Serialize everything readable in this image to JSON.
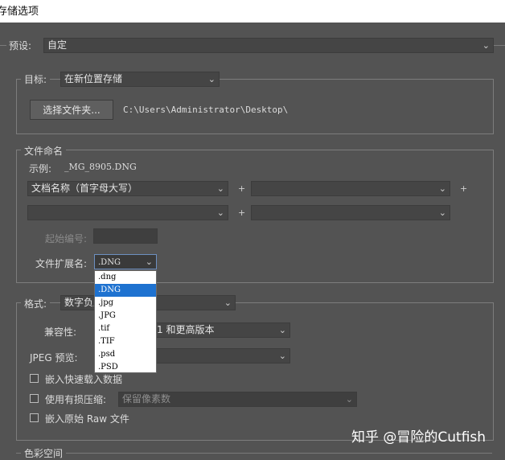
{
  "window": {
    "title": "存储选项"
  },
  "preset": {
    "label": "预设:",
    "value": "自定"
  },
  "destination": {
    "label": "目标:",
    "value": "在新位置存储",
    "select_folder_button": "选择文件夹...",
    "path": "C:\\Users\\Administrator\\Desktop\\"
  },
  "file_naming": {
    "legend": "文件命名",
    "example_label": "示例:",
    "example_value": "_MG_8905.DNG",
    "field1": "文档名称（首字母大写）",
    "field2": "",
    "field3": "",
    "field4": "",
    "start_number_label": "起始编号:",
    "start_number_value": "",
    "extension_label": "文件扩展名:",
    "extension_value": ".DNG",
    "extension_options": [
      ".dng",
      ".DNG",
      ".jpg",
      ".JPG",
      ".tif",
      ".TIF",
      ".psd",
      ".PSD"
    ],
    "extension_selected_index": 1
  },
  "format": {
    "legend": "格式:",
    "value": "数字负片",
    "compatibility_label": "兼容性:",
    "compatibility_value": "1 和更高版本",
    "jpeg_preview_label": "JPEG 预览:",
    "jpeg_preview_value": "",
    "embed_fast_load": "嵌入快速载入数据",
    "lossy_compression": "使用有损压缩:",
    "lossy_value": "保留像素数",
    "embed_raw": "嵌入原始 Raw 文件"
  },
  "color_space": {
    "legend": "色彩空间"
  },
  "watermark": "知乎 @冒险的Cutfish",
  "colors": {
    "background": "#535353",
    "selection": "#1e72d0"
  }
}
